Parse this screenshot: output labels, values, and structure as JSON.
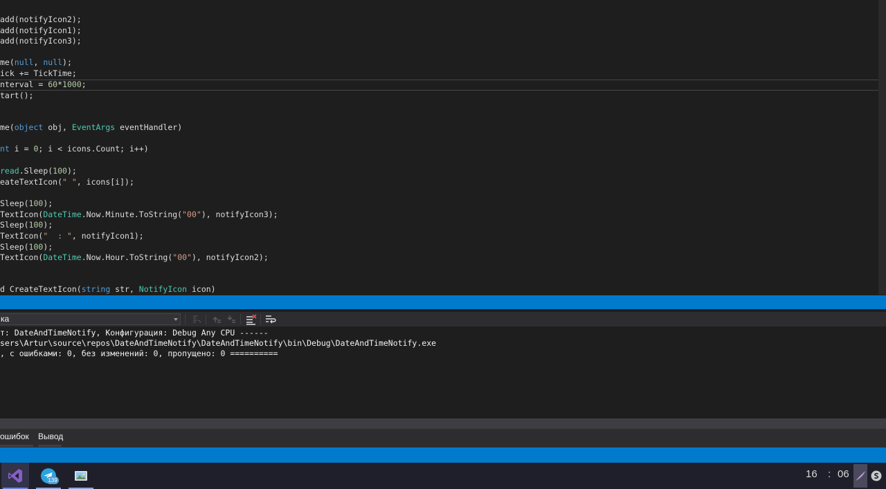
{
  "editor": {
    "lines": [
      [
        {
          "t": "add(notifyIcon2);",
          "c": "pl"
        }
      ],
      [
        {
          "t": "add(notifyIcon1);",
          "c": "pl"
        }
      ],
      [
        {
          "t": "add(notifyIcon3);",
          "c": "pl"
        }
      ],
      [
        {
          "t": "me(",
          "c": "pl"
        },
        {
          "t": "null",
          "c": "kw"
        },
        {
          "t": ", ",
          "c": "pl"
        },
        {
          "t": "null",
          "c": "kw"
        },
        {
          "t": ");",
          "c": "pl"
        }
      ],
      [
        {
          "t": "ick += TickTime;",
          "c": "pl"
        }
      ],
      [
        {
          "t": "nterval = ",
          "c": "pl"
        },
        {
          "t": "60",
          "c": "num"
        },
        {
          "t": "*",
          "c": "pl"
        },
        {
          "t": "1000",
          "c": "num"
        },
        {
          "t": ";",
          "c": "pl"
        }
      ],
      [
        {
          "t": "tart();",
          "c": "pl"
        }
      ],
      [
        {
          "t": "me(",
          "c": "pl"
        },
        {
          "t": "object",
          "c": "kw"
        },
        {
          "t": " obj, ",
          "c": "pl"
        },
        {
          "t": "EventArgs",
          "c": "typ"
        },
        {
          "t": " eventHandler)",
          "c": "pl"
        }
      ],
      [
        {
          "t": "nt",
          "c": "kw"
        },
        {
          "t": " i = ",
          "c": "pl"
        },
        {
          "t": "0",
          "c": "num"
        },
        {
          "t": "; i < icons.Count; i++)",
          "c": "pl"
        }
      ],
      [
        {
          "t": "read",
          "c": "typ"
        },
        {
          "t": ".Sleep(",
          "c": "pl"
        },
        {
          "t": "100",
          "c": "num"
        },
        {
          "t": ");",
          "c": "pl"
        }
      ],
      [
        {
          "t": "eateTextIcon(",
          "c": "pl"
        },
        {
          "t": "\" \"",
          "c": "str"
        },
        {
          "t": ", icons[i]);",
          "c": "pl"
        }
      ],
      [
        {
          "t": "Sleep(",
          "c": "pl"
        },
        {
          "t": "100",
          "c": "num"
        },
        {
          "t": ");",
          "c": "pl"
        }
      ],
      [
        {
          "t": "TextIcon(",
          "c": "pl"
        },
        {
          "t": "DateTime",
          "c": "typ"
        },
        {
          "t": ".Now.Minute.ToString(",
          "c": "pl"
        },
        {
          "t": "\"00\"",
          "c": "str"
        },
        {
          "t": "), notifyIcon3);",
          "c": "pl"
        }
      ],
      [
        {
          "t": "Sleep(",
          "c": "pl"
        },
        {
          "t": "100",
          "c": "num"
        },
        {
          "t": ");",
          "c": "pl"
        }
      ],
      [
        {
          "t": "TextIcon(",
          "c": "pl"
        },
        {
          "t": "\"  : \"",
          "c": "str"
        },
        {
          "t": ", notifyIcon1);",
          "c": "pl"
        }
      ],
      [
        {
          "t": "Sleep(",
          "c": "pl"
        },
        {
          "t": "100",
          "c": "num"
        },
        {
          "t": ");",
          "c": "pl"
        }
      ],
      [
        {
          "t": "TextIcon(",
          "c": "pl"
        },
        {
          "t": "DateTime",
          "c": "typ"
        },
        {
          "t": ".Now.Hour.ToString(",
          "c": "pl"
        },
        {
          "t": "\"00\"",
          "c": "str"
        },
        {
          "t": "), notifyIcon2);",
          "c": "pl"
        }
      ],
      [
        {
          "t": "d CreateTextIcon(",
          "c": "pl"
        },
        {
          "t": "string",
          "c": "kw"
        },
        {
          "t": " str, ",
          "c": "pl"
        },
        {
          "t": "NotifyIcon",
          "c": "typ"
        },
        {
          "t": " icon)",
          "c": "pl"
        }
      ]
    ]
  },
  "output": {
    "source_selected": "ка",
    "lines": [
      "т: DateAndTimeNotify, Конфигурация: Debug Any CPU ------",
      "sers\\Artur\\source\\repos\\DateAndTimeNotify\\DateAndTimeNotify\\bin\\Debug\\DateAndTimeNotify.exe",
      ", с ошибками: 0, без изменений: 0, пропущено: 0 =========="
    ]
  },
  "bottom_tabs": [
    {
      "label": "ошибок"
    },
    {
      "label": "Вывод"
    }
  ],
  "taskbar": {
    "apps": [
      {
        "name": "visual-studio",
        "icon": "visual-studio-icon",
        "active": true
      },
      {
        "name": "telegram",
        "icon": "telegram-icon",
        "badge": "139"
      },
      {
        "name": "file-viewer",
        "icon": "image-viewer-icon"
      }
    ],
    "clock": {
      "hours": "16",
      "separator": ":",
      "minutes": "06"
    }
  },
  "colors": {
    "accent": "#007acc",
    "editor_bg": "#1e1e1e",
    "keyword": "#569cd6",
    "number": "#b5cea8",
    "string": "#d69d85",
    "type": "#4ec9b0",
    "text": "#dcdcdc"
  }
}
